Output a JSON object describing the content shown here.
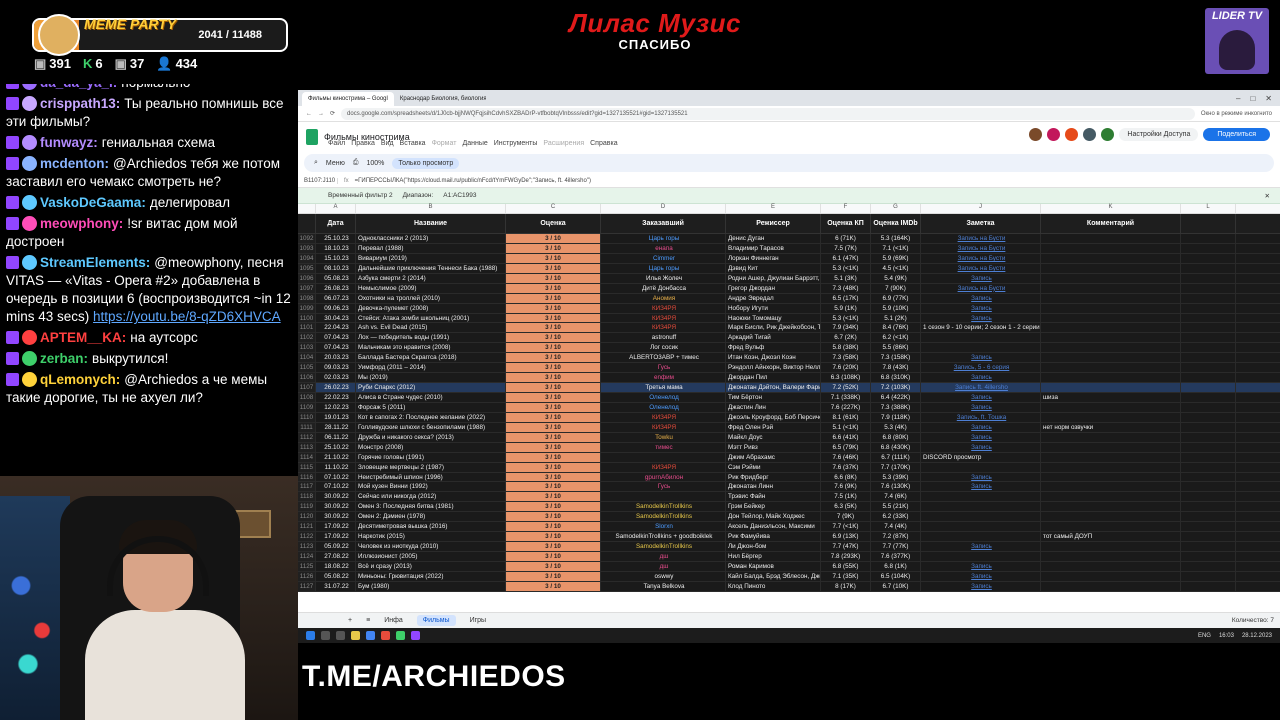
{
  "banner": {
    "title": "Лилас Музис",
    "subtitle": "СПАСИБО"
  },
  "lider": {
    "label": "LIDER TV"
  },
  "meme_party": {
    "label": "MEME PARTY",
    "progress_text": "2041 / 11488",
    "progress": 0.178
  },
  "stats": [
    {
      "icon": "gift-icon",
      "value": "391"
    },
    {
      "icon": "k-icon",
      "value": "6"
    },
    {
      "icon": "gift-icon",
      "value": "37"
    },
    {
      "icon": "users-icon",
      "value": "434"
    }
  ],
  "chat": [
    {
      "user": "da_da_ya_i",
      "color": "#9b6cff",
      "text": "нормально",
      "partial": true
    },
    {
      "user": "crisppath13",
      "color": "#c8a8ff",
      "text": "Ты реально помнишь все эти фильмы?"
    },
    {
      "user": "funwayz",
      "color": "#b48cff",
      "text": "гениальная схема"
    },
    {
      "user": "mcdenton",
      "color": "#8ab4ff",
      "text": "@Archiedos тебя же потом заставил его чемакс смотреть не?"
    },
    {
      "user": "VaskoDeGaama",
      "color": "#5ec9ff",
      "text": "делегировал"
    },
    {
      "user": "meowphony",
      "color": "#ff4db8",
      "text": "!sr витас дом мой достроен"
    },
    {
      "user": "StreamElements",
      "color": "#5ec9ff",
      "text": "@meowphony, песня VITAS — «Vitas - Opera #2» добавлена в очередь в позиции 6 (воспроизводится ~in 12 mins 43 secs)",
      "link": "https://youtu.be/8-qZD6XHVCA"
    },
    {
      "user": "APTEM__KA",
      "color": "#ff4040",
      "text": "на аутсорс"
    },
    {
      "user": "zerban",
      "color": "#3ecf6a",
      "text": "выкрутился!"
    },
    {
      "user": "qLemonych",
      "color": "#ffd23a",
      "text": "@Archiedos а че мемы такие дорогие, ты не ахуел ли?"
    }
  ],
  "bottom_label": "T.ME/ARCHIEDOS",
  "browser": {
    "tabs": [
      "Фильмы кинострима – Googl",
      "Краснодар Биология, биология"
    ],
    "active_tab": 0,
    "right_tab": "Окно в режиме инкогнито",
    "url": "docs.google.com/spreadsheets/d/1J0cb-bjjNWQFqjsihCdvhSXZBADrP-vtfbobtqVlnbsss/edit?gid=1327135521#gid=1327135521"
  },
  "sheet": {
    "title": "Фильмы кинострима",
    "menu": [
      "Файл",
      "Правка",
      "Вид",
      "Вставка",
      "Формат",
      "Данные",
      "Инструменты",
      "Расширения",
      "Справка"
    ],
    "menu_dim": [
      "Формат",
      "Расширения"
    ],
    "access_btn": "Настройки Доступа",
    "share_btn": "Поделиться",
    "toolbar": {
      "menus": "Меню",
      "zoom": "100%",
      "mode": "Только просмотр"
    },
    "cell_ref": "B1107:J110",
    "formula": "=ГИПЕРССЫЛКА(\"https://cloud.mail.ru/public/nFcd/tYmFWGyDe\";\"Запись, ft. 4illersho\")",
    "filter_label": "Временный фильтр 2",
    "filter_range_label": "Диапазон:",
    "filter_range": "A1:AC1993",
    "col_letters": [
      "A",
      "B",
      "C",
      "D",
      "E",
      "F",
      "G",
      "J",
      "K",
      "L"
    ],
    "headers": [
      "Дата",
      "Название",
      "Оценка",
      "Заказавший",
      "Режиссер",
      "Оценка КП",
      "Оценка IMDb",
      "Заметка",
      "Комментарий"
    ],
    "sheet_tabs": [
      "Инфа",
      "Фильмы",
      "Игры"
    ],
    "active_sheet": "Фильмы",
    "qty_label": "Количество: 7"
  },
  "rows": [
    {
      "n": "1092",
      "date": "25.10.23",
      "title": "Одноклассники 2 (2013)",
      "score": "3 / 10",
      "who": "Царь горы",
      "who_color": "#4d9cff",
      "dir": "Денис Дуган",
      "kp": "6 (71K)",
      "imdb": "5.3 (164K)",
      "note": "Запись на Бусти",
      "cmt": ""
    },
    {
      "n": "1093",
      "date": "18.10.23",
      "title": "Перевал (1988)",
      "score": "3 / 10",
      "who": "енапа",
      "who_color": "#e74c8c",
      "dir": "Владимир Тарасов",
      "kp": "7.5 (7K)",
      "imdb": "7.1 (<1K)",
      "note": "Запись на Бусти",
      "cmt": ""
    },
    {
      "n": "1094",
      "date": "15.10.23",
      "title": "Вивариум (2019)",
      "score": "3 / 10",
      "who": "Cimmer",
      "who_color": "#4d9cff",
      "dir": "Лоркан Финнеган",
      "kp": "6.1 (47K)",
      "imdb": "5.9 (69K)",
      "note": "Запись на Бусти",
      "cmt": ""
    },
    {
      "n": "1095",
      "date": "08.10.23",
      "title": "Дальнейшие приключения Теннеси Бака (1988)",
      "score": "3 / 10",
      "who": "Царь горы",
      "who_color": "#4d9cff",
      "dir": "Дэвид Кит",
      "kp": "5.3 (<1K)",
      "imdb": "4.5 (<1K)",
      "note": "Запись на Бусти",
      "cmt": ""
    },
    {
      "n": "1096",
      "date": "05.08.23",
      "title": "Азбука смерти 2 (2014)",
      "score": "3 / 10",
      "who": "Илья Жолеч",
      "who_color": "#eeeeee",
      "dir": "Родни Ашер, Джулиан Баррэтт,",
      "kp": "5.1 (3K)",
      "imdb": "5.4 (9K)",
      "note": "Запись",
      "cmt": ""
    },
    {
      "n": "1097",
      "date": "26.08.23",
      "title": "Немыслимое (2009)",
      "score": "3 / 10",
      "who": "Дитё Донбасса",
      "who_color": "#eeeeee",
      "dir": "Грегор Джордан",
      "kp": "7.3 (48K)",
      "imdb": "7 (90K)",
      "note": "Запись на Бусти",
      "cmt": ""
    },
    {
      "n": "1098",
      "date": "06.07.23",
      "title": "Охотники на троллей (2010)",
      "score": "3 / 10",
      "who": "Аномия",
      "who_color": "#e8b04a",
      "dir": "Андре Эвредал",
      "kp": "6.5 (17K)",
      "imdb": "6.9 (77K)",
      "note": "Запись",
      "cmt": ""
    },
    {
      "n": "1099",
      "date": "09.06.23",
      "title": "Девочка-пулемет (2008)",
      "score": "3 / 10",
      "who": "КИЗ4РЯ",
      "who_color": "#e74c3c",
      "dir": "Нобору Игути",
      "kp": "5.9 (1K)",
      "imdb": "5.9 (10K)",
      "note": "Запись",
      "cmt": ""
    },
    {
      "n": "1100",
      "date": "30.04.23",
      "title": "Стейси: Атака зомби школьниц (2001)",
      "score": "3 / 10",
      "who": "КИЗ4РЯ",
      "who_color": "#e74c3c",
      "dir": "Наоюки Томомацу",
      "kp": "5.3 (<1K)",
      "imdb": "5.1 (2K)",
      "note": "Запись",
      "cmt": ""
    },
    {
      "n": "1101",
      "date": "22.04.23",
      "title": "Ash vs. Evil Dead (2015)",
      "score": "3 / 10",
      "who": "КИЗ4РЯ",
      "who_color": "#e74c3c",
      "dir": "Марк Бисли, Рик Джейкобсон, Т",
      "kp": "7.9 (34K)",
      "imdb": "8.4 (76K)",
      "note": "1 сезон 9 - 10 серии; 2 сезон 1 - 2 серии",
      "note_plain": true,
      "cmt": ""
    },
    {
      "n": "1102",
      "date": "07.04.23",
      "title": "Лох — победитель воды (1991)",
      "score": "3 / 10",
      "who": "astronuff",
      "who_color": "#eeeeee",
      "dir": "Аркадий Тигай",
      "kp": "6.7 (2K)",
      "imdb": "6.2 (<1K)",
      "note": "",
      "cmt": ""
    },
    {
      "n": "1103",
      "date": "07.04.23",
      "title": "Мальчикам это нравится (2008)",
      "score": "3 / 10",
      "who": "Лог сосик",
      "who_color": "#eeeeee",
      "dir": "Фред Вульф",
      "kp": "5.8 (38K)",
      "imdb": "5.5 (86K)",
      "note": "",
      "cmt": ""
    },
    {
      "n": "1104",
      "date": "20.03.23",
      "title": "Баллада Бастера Скраггса (2018)",
      "score": "3 / 10",
      "who": "ALBERTO3ABP + тимес",
      "who_color": "#eeeeee",
      "dir": "Итан Коэн, Джоэл Коэн",
      "kp": "7.3 (58K)",
      "imdb": "7.3 (158K)",
      "note": "Запись",
      "cmt": ""
    },
    {
      "n": "1105",
      "date": "09.03.23",
      "title": "Уимфорд (2011 – 2014)",
      "score": "3 / 10",
      "who": "Гусь",
      "who_color": "#e74c8c",
      "dir": "Рэндолл Айнхорн, Виктор Нелл",
      "kp": "7.6 (20K)",
      "imdb": "7.8 (43K)",
      "note": "Запись, 5 - 6 серия",
      "cmt": ""
    },
    {
      "n": "1106",
      "date": "02.03.23",
      "title": "Мы (2019)",
      "score": "3 / 10",
      "who": "enфим",
      "who_color": "#e74c8c",
      "dir": "Джордан Пил",
      "kp": "6.3 (108K)",
      "imdb": "6.8 (310K)",
      "note": "Запись",
      "cmt": ""
    },
    {
      "n": "1107",
      "date": "26.02.23",
      "title": "Руби Спаркс (2012)",
      "score": "3 / 10",
      "who": "Третья мама",
      "who_color": "#eeeeee",
      "dir": "Джонатан Дэйтон, Валери Фари",
      "kp": "7.2 (52K)",
      "imdb": "7.2 (103K)",
      "note": "Запись ft. 4illersho",
      "cmt": "",
      "sel": true
    },
    {
      "n": "1108",
      "date": "22.02.23",
      "title": "Алиса в Стране чудес (2010)",
      "score": "3 / 10",
      "who": "Оленелод",
      "who_color": "#4d9cff",
      "dir": "Тим Бёртон",
      "kp": "7.1 (338K)",
      "imdb": "6.4 (422K)",
      "note": "Запись",
      "cmt": "шиза"
    },
    {
      "n": "1109",
      "date": "12.02.23",
      "title": "Форсаж 5 (2011)",
      "score": "3 / 10",
      "who": "Оленелод",
      "who_color": "#4d9cff",
      "dir": "Джастин Лин",
      "kp": "7.6 (227K)",
      "imdb": "7.3 (388K)",
      "note": "Запись",
      "cmt": ""
    },
    {
      "n": "1110",
      "date": "19.01.23",
      "title": "Кот в сапогах 2: Последнее желание (2022)",
      "score": "3 / 10",
      "who": "КИЗ4РЯ",
      "who_color": "#e74c3c",
      "dir": "Джоэль Кроуфорд, Боб Персиче",
      "kp": "8.1 (61K)",
      "imdb": "7.9 (118K)",
      "note": "Запись, ft. Тошка",
      "cmt": ""
    },
    {
      "n": "1111",
      "date": "28.11.22",
      "title": "Голливудские шлюхи с бензопилами (1988)",
      "score": "3 / 10",
      "who": "КИЗ4РЯ",
      "who_color": "#e74c3c",
      "dir": "Фред Олен Рэй",
      "kp": "5.1 (<1K)",
      "imdb": "5.3 (4K)",
      "note": "Запись",
      "cmt": "нет норм озвучки"
    },
    {
      "n": "1112",
      "date": "06.11.22",
      "title": "Дружба и никакого секса? (2013)",
      "score": "3 / 10",
      "who": "Towku",
      "who_color": "#e8b04a",
      "dir": "Майкл Доус",
      "kp": "6.6 (41K)",
      "imdb": "6.8 (80K)",
      "note": "Запись",
      "cmt": ""
    },
    {
      "n": "1113",
      "date": "25.10.22",
      "title": "Монстро (2008)",
      "score": "3 / 10",
      "who": "тимес",
      "who_color": "#e74c8c",
      "dir": "Мэтт Ривз",
      "kp": "6.5 (79K)",
      "imdb": "6.8 (430K)",
      "note": "Запись",
      "cmt": ""
    },
    {
      "n": "1114",
      "date": "21.10.22",
      "title": "Горячие головы (1991)",
      "score": "3 / 10",
      "who": "",
      "who_color": "#eeeeee",
      "dir": "Джим Абрахамс",
      "kp": "7.6 (46K)",
      "imdb": "6.7 (111K)",
      "note": "DISCORD просмотр",
      "note_plain": true,
      "cmt": ""
    },
    {
      "n": "1115",
      "date": "11.10.22",
      "title": "Зловещие мертвецы 2 (1987)",
      "score": "3 / 10",
      "who": "КИЗ4РЯ",
      "who_color": "#e74c3c",
      "dir": "Сэм Рэйми",
      "kp": "7.6 (37K)",
      "imdb": "7.7 (170K)",
      "note": "",
      "cmt": ""
    },
    {
      "n": "1116",
      "date": "07.10.22",
      "title": "Неистребимый шпион (1996)",
      "score": "3 / 10",
      "who": "gpurnАбилон",
      "who_color": "#e74c8c",
      "dir": "Рик Фридберг",
      "kp": "6.6 (8K)",
      "imdb": "5.3 (39K)",
      "note": "Запись",
      "cmt": ""
    },
    {
      "n": "1117",
      "date": "07.10.22",
      "title": "Мой кузен Винни (1992)",
      "score": "3 / 10",
      "who": "Гусь",
      "who_color": "#e74c8c",
      "dir": "Джонатан Линн",
      "kp": "7.6 (9K)",
      "imdb": "7.6 (130K)",
      "note": "Запись",
      "cmt": ""
    },
    {
      "n": "1118",
      "date": "30.09.22",
      "title": "Сейчас или никогда (2012)",
      "score": "3 / 10",
      "who": "",
      "who_color": "#eeeeee",
      "dir": "Трэвис Файн",
      "kp": "7.5 (1K)",
      "imdb": "7.4 (6K)",
      "note": "",
      "cmt": ""
    },
    {
      "n": "1119",
      "date": "30.09.22",
      "title": "Омен 3: Последняя битва (1981)",
      "score": "3 / 10",
      "who": "SamodelkinTrollkins",
      "who_color": "#e8c84a",
      "dir": "Грэм Бейкер",
      "kp": "6.3 (5K)",
      "imdb": "5.5 (21K)",
      "note": "",
      "cmt": ""
    },
    {
      "n": "1120",
      "date": "30.09.22",
      "title": "Омен 2: Дэмиен (1978)",
      "score": "3 / 10",
      "who": "SamodelkinTrollkins",
      "who_color": "#e8c84a",
      "dir": "Дон Тейлор, Майк Ходжес",
      "kp": "7 (9K)",
      "imdb": "6.2 (33K)",
      "note": "",
      "cmt": ""
    },
    {
      "n": "1121",
      "date": "17.09.22",
      "title": "Десятиметровая вышка (2016)",
      "score": "3 / 10",
      "who": "Slorxn",
      "who_color": "#4d9cff",
      "dir": "Аксель Даниэльсон, Максими",
      "kp": "7.7 (<1K)",
      "imdb": "7.4 (4K)",
      "note": "",
      "cmt": ""
    },
    {
      "n": "1122",
      "date": "17.09.22",
      "title": "Наркотик (2015)",
      "score": "3 / 10",
      "who": "SamodelkinTrollkins + goodboiklek",
      "who_color": "#eeeeee",
      "dir": "Рик Фамуйива",
      "kp": "6.9 (13K)",
      "imdb": "7.2 (87K)",
      "note": "",
      "cmt": "тот самый ДОУП"
    },
    {
      "n": "1123",
      "date": "05.09.22",
      "title": "Человек из ниоткуда (2010)",
      "score": "3 / 10",
      "who": "SamodelkinTrollkins",
      "who_color": "#e8c84a",
      "dir": "Ли Джон-бом",
      "kp": "7.7 (47K)",
      "imdb": "7.7 (77K)",
      "note": "Запись",
      "cmt": ""
    },
    {
      "n": "1124",
      "date": "27.08.22",
      "title": "Иллюзионист (2005)",
      "score": "3 / 10",
      "who": "дш",
      "who_color": "#e74c8c",
      "dir": "Нил Бёргер",
      "kp": "7.8 (293K)",
      "imdb": "7.6 (377K)",
      "note": "",
      "cmt": ""
    },
    {
      "n": "1125",
      "date": "18.08.22",
      "title": "Всё и сразу (2013)",
      "score": "3 / 10",
      "who": "дш",
      "who_color": "#e74c8c",
      "dir": "Роман Каримов",
      "kp": "6.8 (55K)",
      "imdb": "6.8 (1K)",
      "note": "Запись",
      "cmt": ""
    },
    {
      "n": "1126",
      "date": "05.08.22",
      "title": "Миньоны: Грювитация (2022)",
      "score": "3 / 10",
      "who": "oswwy",
      "who_color": "#eeeeee",
      "dir": "Кайл Балда, Брэд Эблесон, Джо",
      "kp": "7.1 (35K)",
      "imdb": "6.5 (104K)",
      "note": "Запись",
      "cmt": ""
    },
    {
      "n": "1127",
      "date": "31.07.22",
      "title": "Бум (1980)",
      "score": "3 / 10",
      "who": "Tanya Belkova",
      "who_color": "#eeeeee",
      "dir": "Клод Пиното",
      "kp": "8 (17K)",
      "imdb": "6.7 (10K)",
      "note": "Запись",
      "cmt": ""
    }
  ],
  "taskbar": {
    "lang": "ENG",
    "time": "16:03",
    "date": "28.12.2023"
  },
  "colors": {
    "score_bg": "#e8946a",
    "link": "#4d7fd4",
    "accent_red": "#e01a1a",
    "twitch": "#9146ff"
  }
}
